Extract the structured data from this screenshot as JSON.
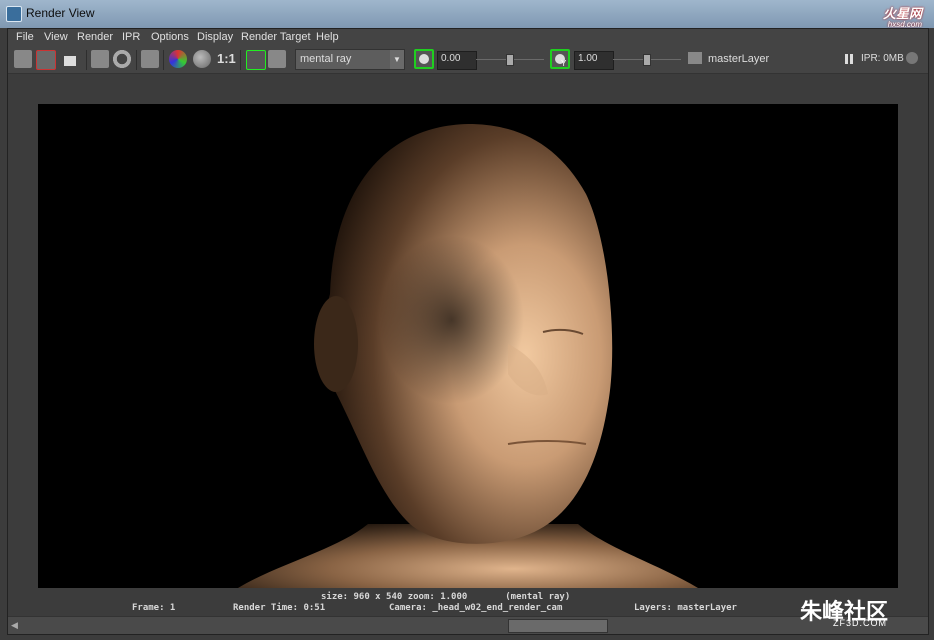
{
  "window": {
    "title": "Render View",
    "watermark_top": "火星网",
    "watermark_top_sub": "hxsd.com"
  },
  "menu": [
    "File",
    "View",
    "Render",
    "IPR",
    "Options",
    "Display",
    "Render Target",
    "Help"
  ],
  "toolbar": {
    "ratio_label": "1:1",
    "renderer": "mental ray",
    "exposure_value": "0.00",
    "gamma_value": "1.00",
    "gamma_badge": "Y",
    "layer_label": "masterLayer",
    "ipr_label": "IPR: 0MB"
  },
  "render_info": {
    "size_line": "size: 960 x 540 zoom: 1.000       (mental ray)",
    "frame": "Frame: 1",
    "render_time": "Render Time: 0:51",
    "camera": "Camera: _head_w02_end_render_cam",
    "layers": "Layers: masterLayer"
  },
  "watermark_bottom": "朱峰社区",
  "watermark_bottom_sub": "ZF3D.COM"
}
